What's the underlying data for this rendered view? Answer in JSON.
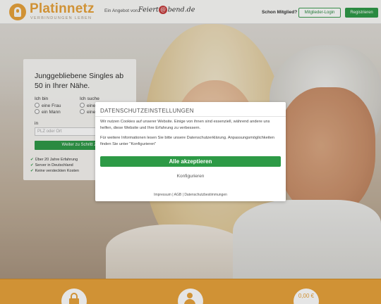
{
  "header": {
    "logo_name": "Platinnetz",
    "logo_tagline": "VERBINDUNGEN LEBEN",
    "offer_prefix": "Ein Angebot von:",
    "offer_brand_part1": "Feiert",
    "offer_brand_at": "@",
    "offer_brand_part2": "bend.de",
    "member_question": "Schon Mitglied?",
    "login_label": "Mitglieder-Login",
    "register_label": "Registrieren"
  },
  "search": {
    "headline": "Junggebliebene Singles ab 50 in Ihrer Nähe.",
    "i_am_label": "Ich bin",
    "i_am_options": [
      "eine Frau",
      "ein Mann"
    ],
    "looking_label": "Ich suche",
    "looking_options": [
      "eine Frau",
      "einen Mann"
    ],
    "in_label": "in",
    "plz_placeholder": "PLZ oder Ort",
    "next_label": "Weiter zu Schritt 2",
    "features": [
      "Über 20 Jahre Erfahrung",
      "Server in Deutschland",
      "Keine versteckten Kosten"
    ]
  },
  "consent": {
    "title": "DATENSCHUTZEINSTELLUNGEN",
    "text1": "Wir nutzen Cookies auf unserer Website. Einige von ihnen sind essenziell, während andere uns helfen, diese Website und Ihre Erfahrung zu verbessern.",
    "text2": "Für weitere Informationen lesen Sie bitte unsere Datenschutzerklärung. Anpassungsmöglichkeiten finden Sie unter \"Konfigurieren\"",
    "accept_label": "Alle akzeptieren",
    "configure_label": "Konfigurieren",
    "links": [
      "Impressum",
      "AGB",
      "Datenschutzbestimmungen"
    ],
    "link_separator": "|"
  },
  "features_band": {
    "price_text": "0,00 €",
    "icons": [
      "lock-icon",
      "person-icon",
      "price-icon"
    ]
  },
  "colors": {
    "brand_orange": "#e8a33c",
    "action_green": "#2f9a49"
  }
}
